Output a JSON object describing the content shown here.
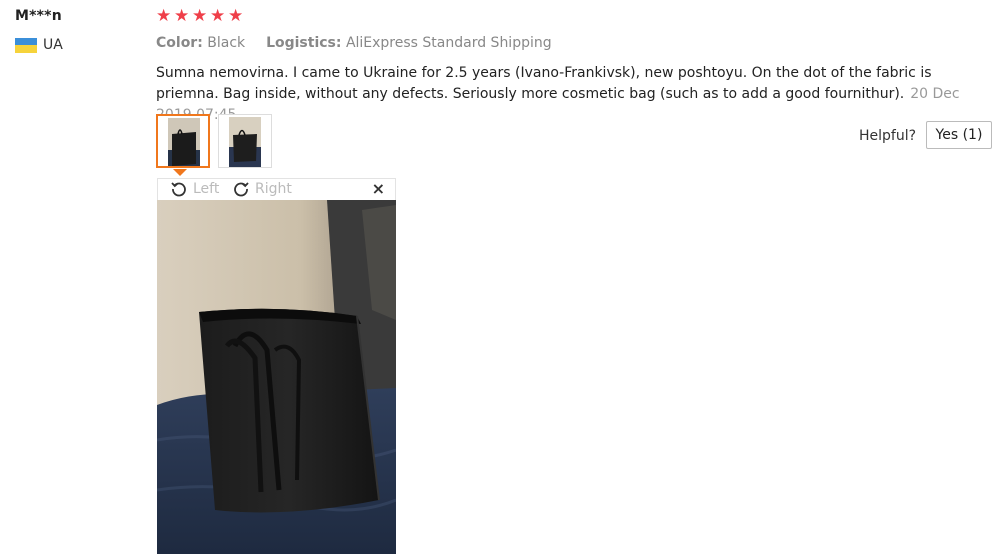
{
  "reviewer": {
    "name": "M***n",
    "country": "UA",
    "flag_colors": [
      "#3b8fd9",
      "#f6d33b"
    ]
  },
  "rating": {
    "stars": 5,
    "max": 5,
    "color": "#ef3f49"
  },
  "attributes": {
    "color_label": "Color:",
    "color_value": "Black",
    "logistics_label": "Logistics:",
    "logistics_value": "AliExpress Standard Shipping"
  },
  "review": {
    "text": "Sumna nemovirna. I came to Ukraine for 2.5 years (Ivano-Frankivsk), new poshtoyu. On the dot of the fabric is priemna. Bag inside, without any defects. Seriously more cosmetic bag (such as to add a good fournithur).",
    "date": "20 Dec 2019 07:45"
  },
  "thumbnails": [
    {
      "selected": true
    },
    {
      "selected": false
    }
  ],
  "helpful": {
    "label": "Helpful?",
    "yes_button": "Yes (1)"
  },
  "viewer": {
    "rotate_left": "Left",
    "rotate_right": "Right",
    "close": "×"
  },
  "accent_color": "#f0771c"
}
